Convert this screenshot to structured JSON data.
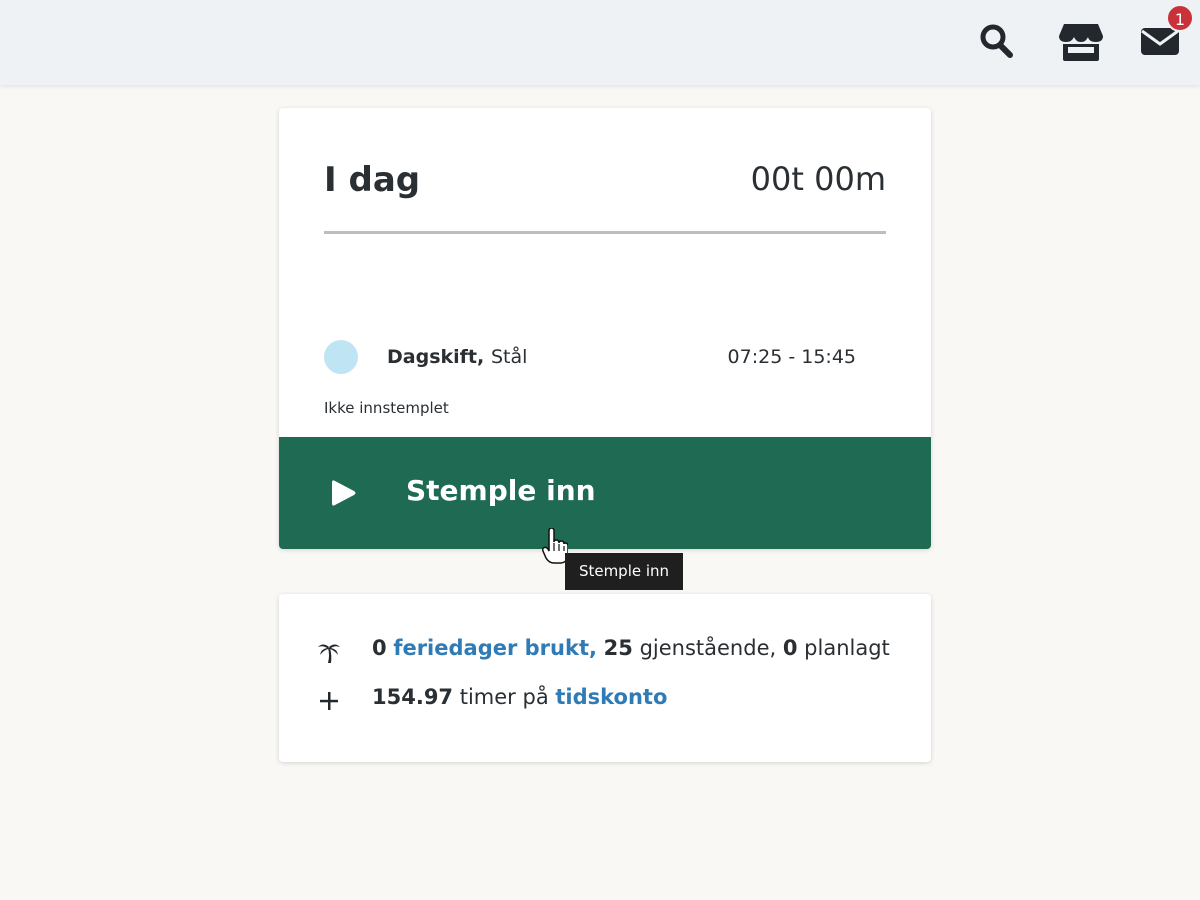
{
  "topbar": {
    "icons": [
      "search-icon",
      "store-icon",
      "mail-icon"
    ],
    "notification_count": "1"
  },
  "today": {
    "title": "I dag",
    "total": "00t 00m",
    "shift": {
      "name": "Dagskift,",
      "department": "Stål",
      "time": "07:25 - 15:45"
    },
    "status": "Ikke innstemplet",
    "clock_in_label": "Stemple inn",
    "tooltip": "Stemple inn"
  },
  "stats": {
    "vacation": {
      "used": "0",
      "used_link": "feriedager brukt,",
      "remaining": "25",
      "remaining_label": "gjenstående,",
      "planned": "0",
      "planned_label": "planlagt"
    },
    "hours": {
      "value": "154.97",
      "label": "timer på",
      "link": "tidskonto"
    }
  },
  "colors": {
    "primary_button": "#1e6a52",
    "link": "#2f7bb6",
    "badge": "#c9323a",
    "shift_dot": "#bfe4f4"
  }
}
